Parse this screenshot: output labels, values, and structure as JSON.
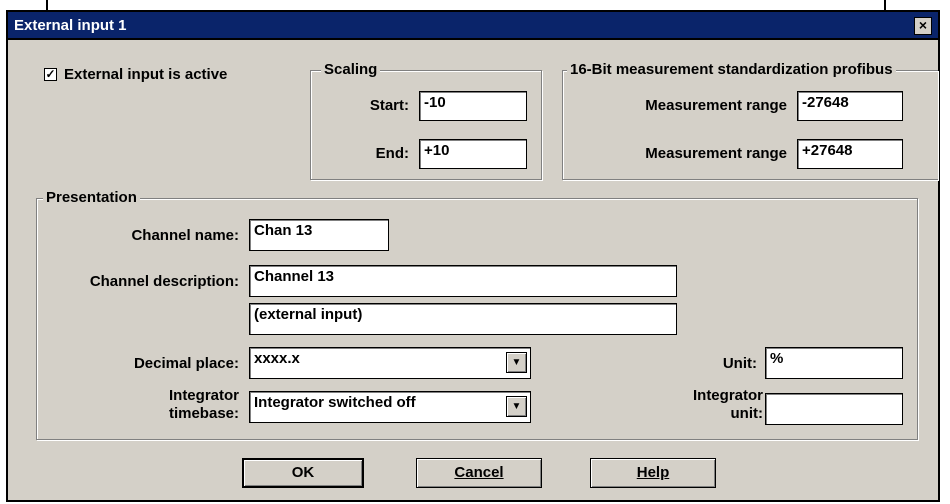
{
  "window": {
    "title": "External input 1",
    "close": "×"
  },
  "active": {
    "label": "External input is active",
    "checked": "✓"
  },
  "scaling": {
    "legend": "Scaling",
    "start_label": "Start:",
    "start_value": "-10",
    "end_label": "End:",
    "end_value": "+10"
  },
  "standardization": {
    "legend": "16-Bit measurement standardization profibus",
    "range1_label": "Measurement range",
    "range1_value": "-27648",
    "range2_label": "Measurement range",
    "range2_value": "+27648"
  },
  "presentation": {
    "legend": "Presentation",
    "channel_name_label": "Channel name:",
    "channel_name_value": "Chan 13",
    "channel_desc_label": "Channel description:",
    "channel_desc_line1": "Channel 13",
    "channel_desc_line2": "(external input)",
    "decimal_label": "Decimal place:",
    "decimal_value": "xxxx.x",
    "unit_label": "Unit:",
    "unit_value": "%",
    "integrator_label_line1": "Integrator",
    "integrator_label_line2": "timebase:",
    "integrator_value": "Integrator switched off",
    "integrator_unit_line1": "Integrator",
    "integrator_unit_line2": "unit:",
    "integrator_unit_value": ""
  },
  "buttons": {
    "ok": "OK",
    "cancel": "Cancel",
    "help": "Help"
  },
  "icons": {
    "dropdown": "chevron-down-icon",
    "check": "check-icon",
    "close": "close-icon"
  }
}
